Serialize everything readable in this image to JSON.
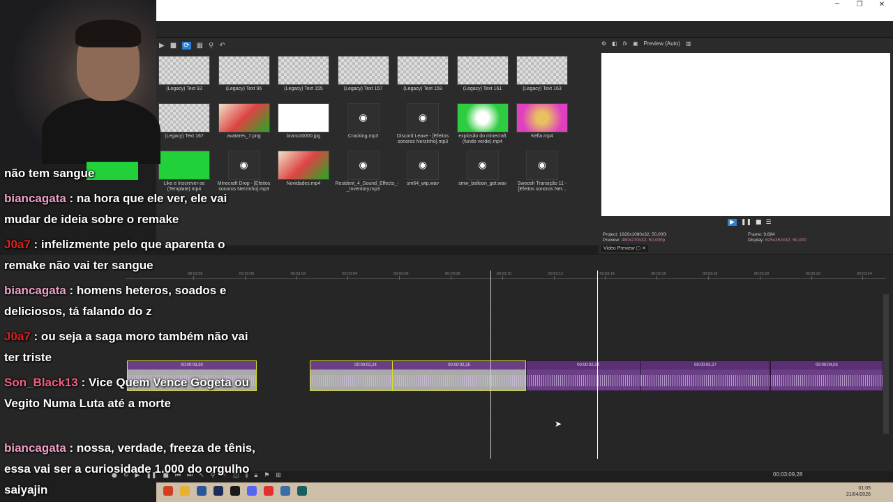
{
  "window": {
    "minimize": "─",
    "restore": "❐",
    "close": "✕"
  },
  "media_toolbar": {
    "icons": [
      "play-icon",
      "stop-icon",
      "view-icon",
      "grid-icon",
      "zoom-icon",
      "undo-icon"
    ]
  },
  "media_items": [
    {
      "label": "(Legacy) Text 93",
      "kind": "checker"
    },
    {
      "label": "(Legacy) Text 96",
      "kind": "checker"
    },
    {
      "label": "(Legacy) Text 155",
      "kind": "checker"
    },
    {
      "label": "(Legacy) Text 157",
      "kind": "checker"
    },
    {
      "label": "(Legacy) Text 159",
      "kind": "checker"
    },
    {
      "label": "(Legacy) Text 161",
      "kind": "checker"
    },
    {
      "label": "(Legacy) Text 163",
      "kind": "checker"
    },
    {
      "label": "(Legacy) Text 167",
      "kind": "checker"
    },
    {
      "label": "avatares_7.png",
      "kind": "image"
    },
    {
      "label": "branco0000.jpg",
      "kind": "white"
    },
    {
      "label": "Cracking.mp3",
      "kind": "audio"
    },
    {
      "label": "Discord Leave - [Efeitos sonoros Nerzinho].mp3",
      "kind": "audio"
    },
    {
      "label": "explosão do minecraft (fundo verde).mp4",
      "kind": "green"
    },
    {
      "label": "Kefla.mp4",
      "kind": "pink"
    },
    {
      "label": "Like e Inscrever-se (Template).mp4",
      "kind": "greenplain"
    },
    {
      "label": "Minecraft Drop - [Efeitos sonoros Nerzinho].mp3",
      "kind": "audio"
    },
    {
      "label": "Novidades.mp4",
      "kind": "image"
    },
    {
      "label": "Resident_4_Sound_Effects_-_Inventory.mp3",
      "kind": "audio"
    },
    {
      "label": "sm64_wip.wav",
      "kind": "audio"
    },
    {
      "label": "smw_balloon_get.wav",
      "kind": "audio"
    },
    {
      "label": "Swoosh Transição 11 - [Efeitos sonoros Ner...",
      "kind": "audio"
    }
  ],
  "preview": {
    "mode": "Preview (Auto)",
    "project": "Project:  1920x1080x32; 50,000i",
    "preview_lbl": "Preview:",
    "preview_val": "480x270x32; 50,000p",
    "frame": "Frame:    9.684",
    "display_lbl": "Display:",
    "display_val": "625x352x32; 50,000",
    "tab": "Video Preview"
  },
  "ruler": [
    "00:02:58",
    "00:03:00",
    "00:03:02",
    "00:03:04",
    "00:03:06",
    "00:03:08",
    "00:03:10",
    "00:03:12",
    "00:03:14",
    "00:03:16",
    "00:03:18",
    "00:03:20",
    "00:03:22",
    "00:03:24"
  ],
  "clips": [
    {
      "label": "00:00:03,30",
      "sel": true
    },
    {
      "label": "00:00:02,24",
      "sel": true
    },
    {
      "label": "00:00:02,25",
      "sel": true
    },
    {
      "label": "00:00:02,34",
      "sel": false
    },
    {
      "label": "00:00:03,27",
      "sel": false
    },
    {
      "label": "00:00:04,03",
      "sel": false
    }
  ],
  "timecode": "00:03:09,28",
  "clock": {
    "time": "01:05",
    "date": "21/04/2026"
  },
  "chat": [
    {
      "user": "",
      "user_color": "#ffffff",
      "text": "não tem sangue"
    },
    {
      "user": "biancagata",
      "user_color": "#f0a0c8",
      "text": " : na hora que ele ver, ele vai mudar de ideia sobre o remake"
    },
    {
      "user": "J0a7",
      "user_color": "#e02020",
      "text": " : infelizmente pelo que aparenta o remake não vai ter sangue"
    },
    {
      "user": "biancagata",
      "user_color": "#f0a0c8",
      "text": " : homens heteros, soados e deliciosos, tá falando do z"
    },
    {
      "user": "J0a7",
      "user_color": "#e02020",
      "text": " : ou seja a saga moro também não vai ter triste"
    },
    {
      "user": "Son_Black13",
      "user_color": "#f06080",
      "text": " : Vice Quem Vence Gogeta ou Vegito Numa Luta até a morte"
    },
    {
      "user": "biancagata",
      "user_color": "#f0a0c8",
      "text": " : nossa, verdade, freeza de tênis, essa vai ser a curiosidade 1.000 do orgulho saiyajin"
    }
  ]
}
